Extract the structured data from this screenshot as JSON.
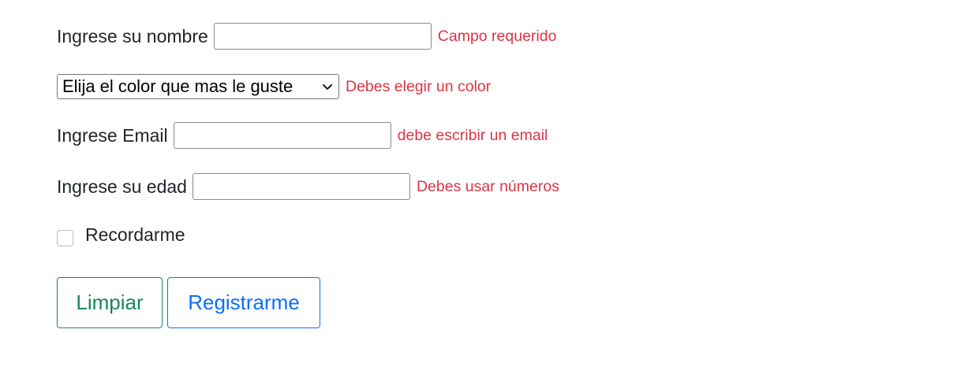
{
  "form": {
    "name": {
      "label": "Ingrese su nombre",
      "value": "",
      "error": "Campo requerido"
    },
    "color": {
      "selected": "Elija el color que mas le guste",
      "error": "Debes elegir un color"
    },
    "email": {
      "label": "Ingrese Email",
      "value": "",
      "error": "debe escribir un email"
    },
    "age": {
      "label": "Ingrese su edad",
      "value": "",
      "error": "Debes usar números"
    },
    "remember": {
      "label": "Recordarme",
      "checked": false
    },
    "buttons": {
      "clear_label": "Limpiar",
      "register_label": "Registrarme"
    }
  },
  "colors": {
    "error": "#dc3545",
    "clear_button": "#198754",
    "register_button": "#0d6efd"
  },
  "icons": {
    "select_arrow": "chevron-down-icon"
  }
}
